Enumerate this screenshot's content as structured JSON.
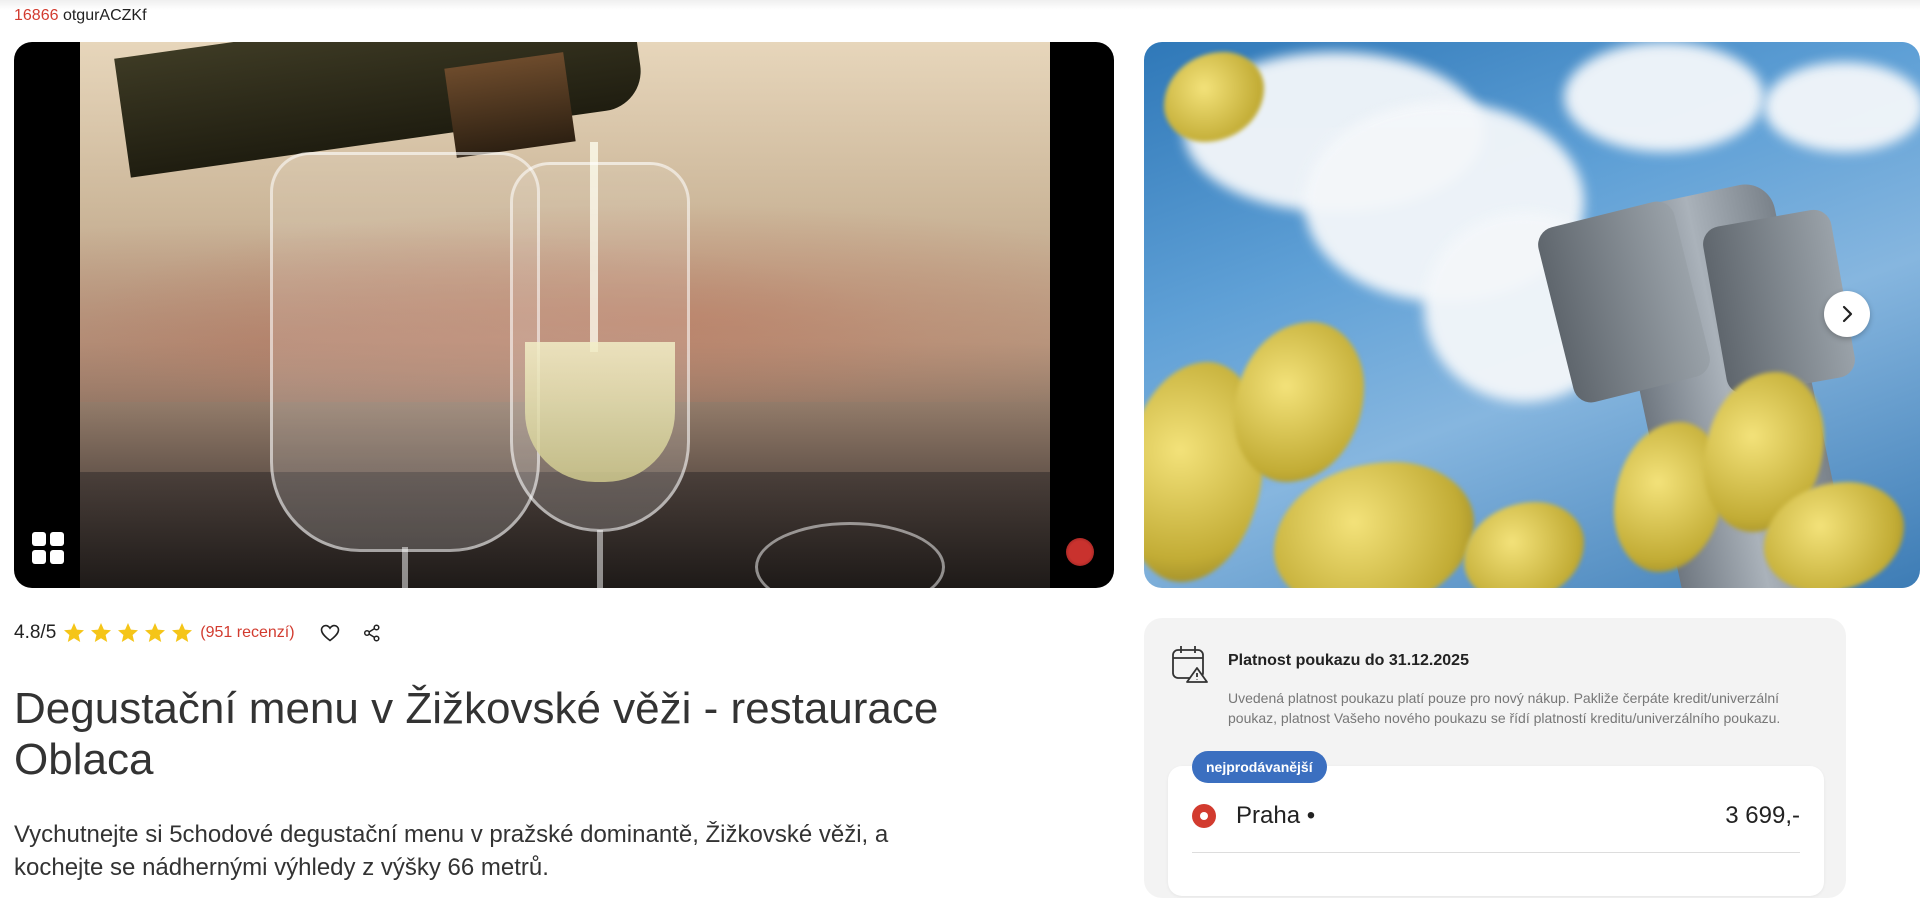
{
  "header": {
    "code_number": "16866",
    "code_text": "otgurACZKf"
  },
  "gallery": {
    "gallery_icon": "grid-icon",
    "badge_icon": "logo-badge-icon",
    "next_icon": "chevron-right-icon"
  },
  "rating": {
    "score": "4.8/5",
    "stars": 5,
    "reviews": "(951 recenzí)",
    "favorite_icon": "heart-icon",
    "share_icon": "share-icon"
  },
  "product": {
    "title": "Degustační menu v Žižkovské věži - restaurace Oblaca",
    "description": "Vychutnejte si 5chodové degustační menu v pražské dominantě, Žižkovské věži, a kochejte se nádhernými výhledy z výšky 66 metrů."
  },
  "voucher": {
    "validity_title": "Platnost poukazu do 31.12.2025",
    "validity_note": "Uvedená platnost poukazu platí pouze pro nový nákup. Pakliže čerpáte kredit/univerzální poukaz, platnost Vašeho nového poukazu se řídí platností kreditu/univerzálního poukazu.",
    "badge": "nejprodávanější",
    "option_city": "Praha •",
    "option_price": "3 699,-"
  },
  "colors": {
    "accent": "#d23b2f",
    "badge": "#3b6fc0",
    "star": "#f5c518"
  }
}
